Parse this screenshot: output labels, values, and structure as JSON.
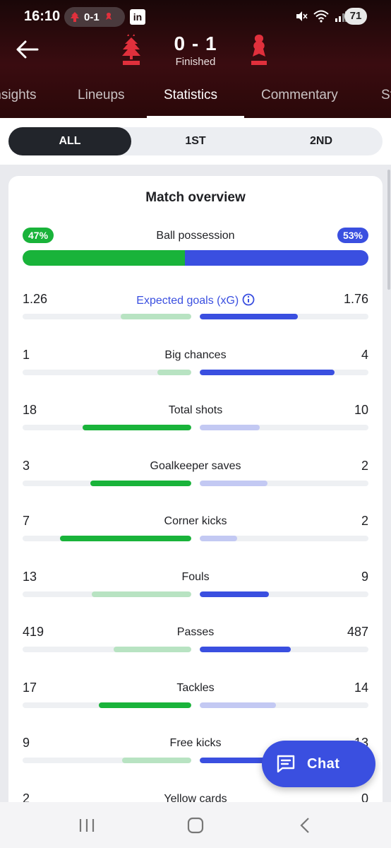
{
  "status_bar": {
    "time": "16:10",
    "pill_score": "0-1",
    "linkedin": "in",
    "battery": "71"
  },
  "header": {
    "score": "0 - 1",
    "status": "Finished",
    "home_team_icon": "nottingham-forest-crest-icon",
    "away_team_icon": "liverpool-crest-icon"
  },
  "tabs": [
    "Insights",
    "Lineups",
    "Statistics",
    "Commentary",
    "St"
  ],
  "active_tab": "Statistics",
  "periods": [
    "ALL",
    "1ST",
    "2ND"
  ],
  "active_period": "ALL",
  "colors": {
    "home_strong": "#19b33a",
    "home_light": "#b8e3c2",
    "away_strong": "#3a4fe0",
    "away_light": "#c3c9f3",
    "track": "#eef0f3"
  },
  "card": {
    "title": "Match overview",
    "possession": {
      "label": "Ball possession",
      "home": "47%",
      "away": "53%",
      "home_fraction": 0.47,
      "away_fraction": 0.53
    },
    "stats": [
      {
        "label": "Expected goals (xG)",
        "home": "1.26",
        "away": "1.76",
        "home_value": 1.26,
        "away_value": 1.76,
        "highlight": "away",
        "info": true
      },
      {
        "label": "Big chances",
        "home": "1",
        "away": "4",
        "home_value": 1,
        "away_value": 4,
        "highlight": "away"
      },
      {
        "label": "Total shots",
        "home": "18",
        "away": "10",
        "home_value": 18,
        "away_value": 10,
        "highlight": "home"
      },
      {
        "label": "Goalkeeper saves",
        "home": "3",
        "away": "2",
        "home_value": 3,
        "away_value": 2,
        "highlight": "home"
      },
      {
        "label": "Corner kicks",
        "home": "7",
        "away": "2",
        "home_value": 7,
        "away_value": 2,
        "highlight": "home"
      },
      {
        "label": "Fouls",
        "home": "13",
        "away": "9",
        "home_value": 13,
        "away_value": 9,
        "highlight": "away"
      },
      {
        "label": "Passes",
        "home": "419",
        "away": "487",
        "home_value": 419,
        "away_value": 487,
        "highlight": "away"
      },
      {
        "label": "Tackles",
        "home": "17",
        "away": "14",
        "home_value": 17,
        "away_value": 14,
        "highlight": "home"
      },
      {
        "label": "Free kicks",
        "home": "9",
        "away": "13",
        "home_value": 9,
        "away_value": 13,
        "highlight": "away"
      },
      {
        "label": "Yellow cards",
        "home": "2",
        "away": "0",
        "home_value": 2,
        "away_value": 0,
        "highlight": "home"
      }
    ]
  },
  "chat": {
    "label": "Chat",
    "icon": "chat-icon"
  }
}
